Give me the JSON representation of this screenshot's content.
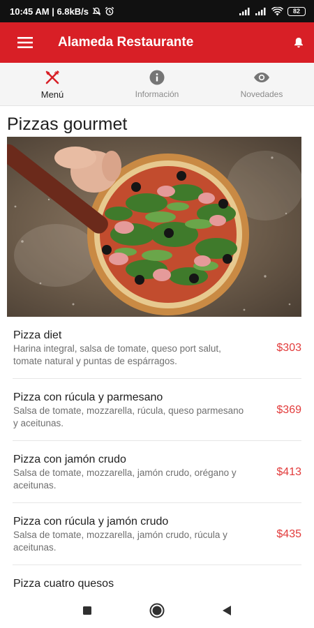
{
  "status_bar": {
    "time_speed": "10:45 AM | 6.8kB/s",
    "battery": "82"
  },
  "app_bar": {
    "title": "Alameda Restaurante"
  },
  "tabs": [
    {
      "label": "Menú",
      "icon": "cutlery-icon",
      "active": true
    },
    {
      "label": "Información",
      "icon": "info-icon",
      "active": false
    },
    {
      "label": "Novedades",
      "icon": "eye-icon",
      "active": false
    }
  ],
  "colors": {
    "primary": "#d81f26",
    "price": "#e23b3b"
  },
  "section": {
    "title": "Pizzas gourmet",
    "image": "pizza-image"
  },
  "items": [
    {
      "name": "Pizza diet",
      "desc": "Harina integral, salsa de tomate, queso port salut, tomate natural y puntas de espárragos.",
      "price": "$303"
    },
    {
      "name": "Pizza con rúcula y parmesano",
      "desc": "Salsa de tomate, mozzarella, rúcula, queso parmesano y aceitunas.",
      "price": "$369"
    },
    {
      "name": "Pizza con jamón crudo",
      "desc": "Salsa de tomate, mozzarella, jamón crudo, orégano y aceitunas.",
      "price": "$413"
    },
    {
      "name": "Pizza con rúcula y jamón crudo",
      "desc": "Salsa de tomate, mozzarella, jamón crudo, rúcula y aceitunas.",
      "price": "$435"
    },
    {
      "name": "Pizza cuatro quesos",
      "desc": "",
      "price": ""
    }
  ]
}
